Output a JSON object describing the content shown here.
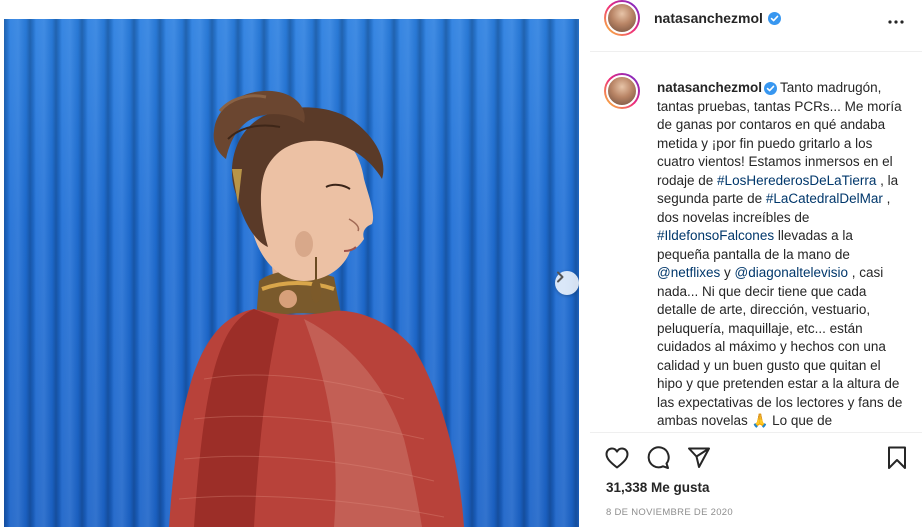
{
  "post": {
    "username": "natasanchezmol",
    "verified": true,
    "likes": "31,338 Me gusta",
    "date": "8 DE NOVIEMBRE DE 2020",
    "image_alt": "Woman in period costume with red shawl in front of a blue corrugated wall"
  },
  "caption": {
    "username": "natasanchezmol",
    "segments": [
      {
        "text": "Tanto madrugón, tantas pruebas, tantas PCRs... Me moría de ganas por contaros en qué andaba metida y ¡por fin puedo gritarlo a los cuatro vientos! Estamos inmersos en el rodaje de ",
        "tag": false
      },
      {
        "text": "#LosHerederosDeLaTierra",
        "tag": true
      },
      {
        "text": " , la segunda parte de ",
        "tag": false
      },
      {
        "text": "#LaCatedralDelMar",
        "tag": true
      },
      {
        "text": " , dos novelas increíbles de ",
        "tag": false
      },
      {
        "text": "#IldefonsoFalcones",
        "tag": true
      },
      {
        "text": " llevadas a la pequeña pantalla de la mano de ",
        "tag": false
      },
      {
        "text": "@netflixes",
        "tag": true
      },
      {
        "text": " y ",
        "tag": false
      },
      {
        "text": "@diagonaltelevisio",
        "tag": true
      },
      {
        "text": " , casi nada... Ni que decir tiene que cada detalle de arte, dirección, vestuario, peluquería, maquillaje, etc... están cuidados al máximo y hechos con una calidad y un buen gusto que quitan el hipo y que pretenden estar a la altura de las expectativas de los lectores y fans de ambas novelas 🙏 Lo que de",
        "tag": false
      }
    ]
  },
  "icons": {
    "more": "more-horizontal-icon",
    "like": "heart-icon",
    "comment": "comment-icon",
    "share": "send-icon",
    "save": "bookmark-icon",
    "next": "chevron-right-icon",
    "verified": "verified-badge-icon"
  },
  "colors": {
    "text": "#262626",
    "link": "#00376b",
    "muted": "#8e8e8e",
    "verified": "#3897f0",
    "wall_blue": "#1f6fd6",
    "shawl_red": "#b8423a"
  }
}
